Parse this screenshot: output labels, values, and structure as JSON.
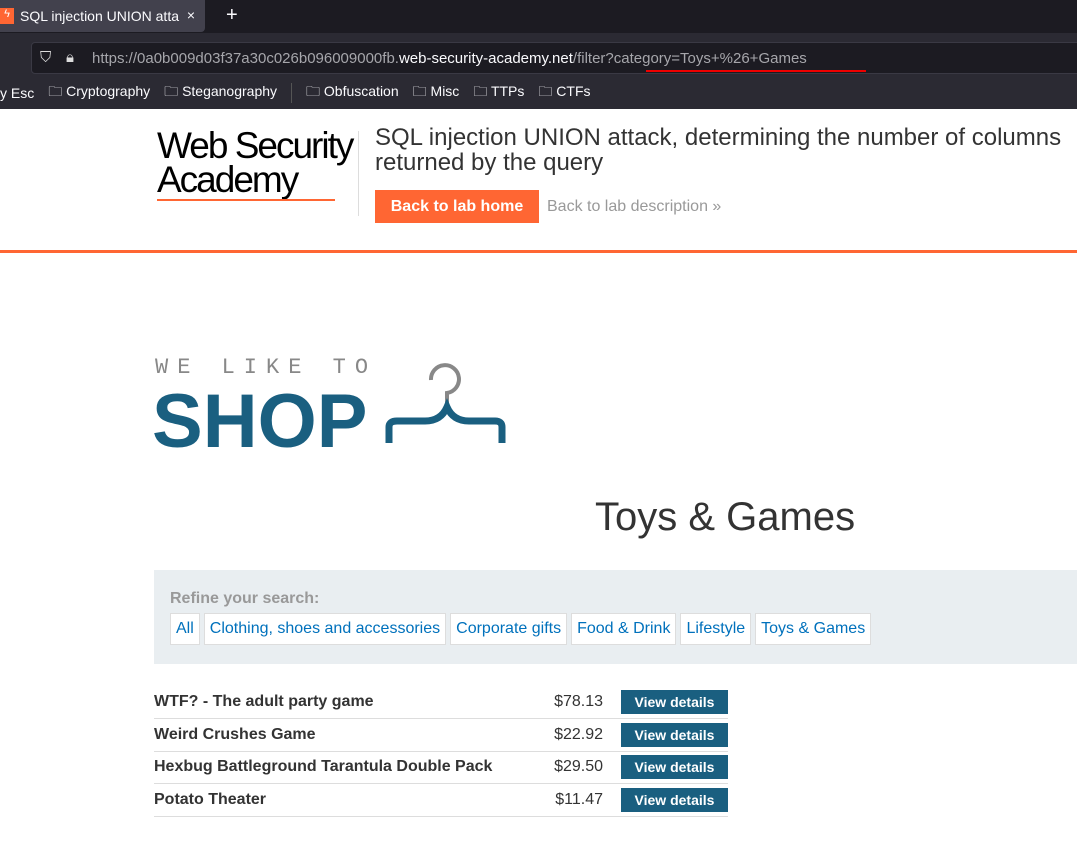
{
  "browser": {
    "tab_title": "SQL injection UNION atta",
    "url_prefix": "https://0a0b009d03f37a30c026b096009000fb.",
    "url_host": "web-security-academy.net",
    "url_path": "/filter?category=Toys+%26+Games",
    "bookmarks": [
      "y Esc",
      "Cryptography",
      "Steganography",
      "Obfuscation",
      "Misc",
      "TTPs",
      "CTFs"
    ]
  },
  "header": {
    "logo_line1": "Web Security",
    "logo_line2": "Academy",
    "title": "SQL injection UNION attack, determining the number of columns returned by the query",
    "back_home": "Back to lab home",
    "back_desc": "Back to lab description »"
  },
  "shop": {
    "tagline": "WE LIKE TO",
    "name": "SHOP"
  },
  "category_title": "Toys & Games",
  "refine": {
    "label": "Refine your search:",
    "filters": [
      "All",
      "Clothing, shoes and accessories",
      "Corporate gifts",
      "Food & Drink",
      "Lifestyle",
      "Toys & Games"
    ]
  },
  "products": [
    {
      "name": "WTF? - The adult party game",
      "price": "$78.13",
      "action": "View details"
    },
    {
      "name": "Weird Crushes Game",
      "price": "$22.92",
      "action": "View details"
    },
    {
      "name": "Hexbug Battleground Tarantula Double Pack",
      "price": "$29.50",
      "action": "View details"
    },
    {
      "name": "Potato Theater",
      "price": "$11.47",
      "action": "View details"
    }
  ]
}
